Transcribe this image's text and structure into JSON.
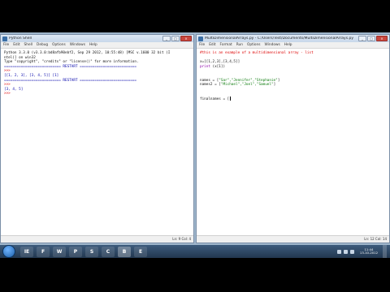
{
  "shell_window": {
    "title": "Python Shell",
    "menu": [
      "File",
      "Edit",
      "Shell",
      "Debug",
      "Options",
      "Windows",
      "Help"
    ],
    "lines": [
      {
        "parts": [
          {
            "t": "Python 3.3.0 (v3.3.0:bd8afb90ebf2, Sep 29 2012, 10:55:48) [MSC v.1600 32 bit (I",
            "c": ""
          }
        ]
      },
      {
        "parts": [
          {
            "t": "ntel)] on win32",
            "c": ""
          }
        ]
      },
      {
        "parts": [
          {
            "t": "Type \"copyright\", \"credits\" or \"license()\" for more information.",
            "c": ""
          }
        ]
      },
      {
        "parts": [
          {
            "t": "=========================== RESTART ===========================",
            "c": "blue"
          }
        ]
      },
      {
        "parts": [
          {
            "t": ">>> ",
            "c": "red"
          }
        ]
      },
      {
        "parts": [
          {
            "t": "[[1, 2, 3], [3, 4, 5]] [1]",
            "c": "blue"
          }
        ]
      },
      {
        "parts": [
          {
            "t": "=========================== RESTART ===========================",
            "c": "blue"
          }
        ]
      },
      {
        "parts": [
          {
            "t": ">>> ",
            "c": "red"
          }
        ]
      },
      {
        "parts": [
          {
            "t": "[3, 4, 5]",
            "c": "blue"
          }
        ]
      },
      {
        "parts": [
          {
            "t": ">>> ",
            "c": "red"
          }
        ]
      }
    ],
    "status": "Ln: 9 Col: 4"
  },
  "editor_window": {
    "title": "MultiDimensionalArrays.py - C:/Users/Test/Documents/MultiDimensionalArrays.py",
    "menu": [
      "File",
      "Edit",
      "Format",
      "Run",
      "Options",
      "Windows",
      "Help"
    ],
    "lines": [
      {
        "parts": [
          {
            "t": "#this is an example of a multidimensional array - list",
            "c": "red"
          }
        ]
      },
      {
        "parts": [
          {
            "t": "",
            "c": ""
          }
        ]
      },
      {
        "parts": [
          {
            "t": "x=[[1,2,3],[3,4,5]]",
            "c": ""
          }
        ]
      },
      {
        "parts": [
          {
            "t": "print",
            "c": "purple"
          },
          {
            "t": " (x[1])",
            "c": ""
          }
        ]
      },
      {
        "parts": [
          {
            "t": "",
            "c": ""
          }
        ]
      },
      {
        "parts": [
          {
            "t": "",
            "c": ""
          }
        ]
      },
      {
        "parts": [
          {
            "t": "names = [",
            "c": ""
          },
          {
            "t": "\"Sar\",\"Jennifer\",\"Stephanie\"",
            "c": "green"
          },
          {
            "t": "]",
            "c": ""
          }
        ]
      },
      {
        "parts": [
          {
            "t": "names2 = [",
            "c": ""
          },
          {
            "t": "\"Michael\",\"Joel\",\"Samuel\"",
            "c": "green"
          },
          {
            "t": "]",
            "c": ""
          }
        ]
      },
      {
        "parts": [
          {
            "t": "",
            "c": ""
          }
        ]
      },
      {
        "parts": [
          {
            "t": "",
            "c": ""
          }
        ]
      },
      {
        "parts": [
          {
            "t": "finalnames = [",
            "c": ""
          }
        ],
        "cursor": true
      }
    ],
    "status": "Ln: 12 Col: 14"
  },
  "taskbar": {
    "apps": [
      "IE",
      "F",
      "W",
      "P",
      "S",
      "C",
      "B",
      "E"
    ],
    "active_index": 6,
    "time": "11:44",
    "date": "13-10-2012"
  }
}
